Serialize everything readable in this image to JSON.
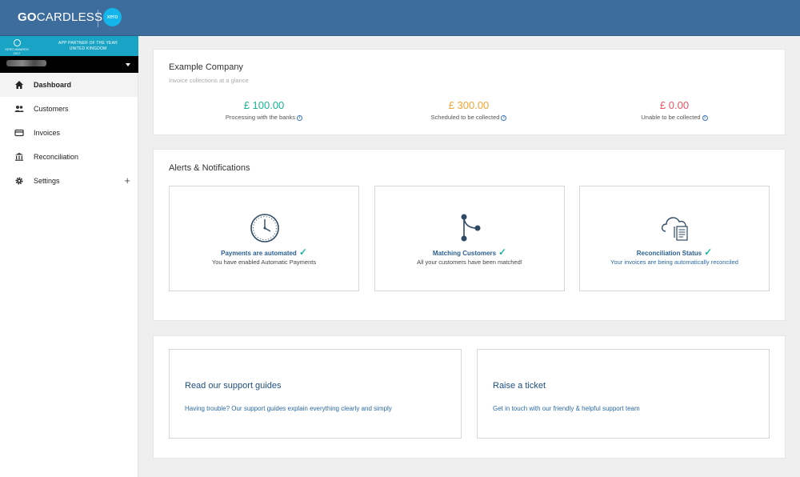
{
  "header": {
    "logo_bold": "GO",
    "logo_rest": "CARDLESS",
    "partner_badge": "xero"
  },
  "sidebar": {
    "award": {
      "badge_text": "XERO AWARDS 2017",
      "line1": "APP PARTNER OF THE YEAR",
      "line2": "UNITED KINGDOM"
    },
    "items": [
      {
        "label": "Dashboard",
        "icon": "home-icon",
        "active": true
      },
      {
        "label": "Customers",
        "icon": "people-icon"
      },
      {
        "label": "Invoices",
        "icon": "card-icon"
      },
      {
        "label": "Reconciliation",
        "icon": "bank-icon"
      },
      {
        "label": "Settings",
        "icon": "gear-icon",
        "expand": "+"
      }
    ]
  },
  "overview": {
    "company": "Example Company",
    "subtitle": "Invoice collections at a glance",
    "stats": [
      {
        "amount": "£ 100.00",
        "caption": "Processing with the banks",
        "color": "#1ab394"
      },
      {
        "amount": "£ 300.00",
        "caption": "Scheduled to be collected",
        "color": "#f3a533"
      },
      {
        "amount": "£ 0.00",
        "caption": "Unable to be collected",
        "color": "#ed5565"
      }
    ]
  },
  "alerts": {
    "title": "Alerts & Notifications",
    "tiles": [
      {
        "heading": "Payments are automated",
        "text": "You have enabled Automatic Payments",
        "icon": "clock-icon"
      },
      {
        "heading": "Matching Customers",
        "text": "All your customers have been matched!",
        "icon": "branch-icon"
      },
      {
        "heading": "Reconciliation Status",
        "text": "Your invoices are being automatically reconciled",
        "icon": "cloud-document-icon"
      }
    ],
    "check": "✓"
  },
  "support": {
    "guides": {
      "heading": "Read our support guides",
      "text": "Having trouble? Our support guides explain everything clearly and simply"
    },
    "ticket": {
      "heading": "Raise a ticket",
      "text": "Get in touch with our friendly & helpful support team"
    }
  },
  "colors": {
    "header": "#3c6d9c",
    "accent_blue": "#2a5f92",
    "check_green": "#22b8a0"
  }
}
